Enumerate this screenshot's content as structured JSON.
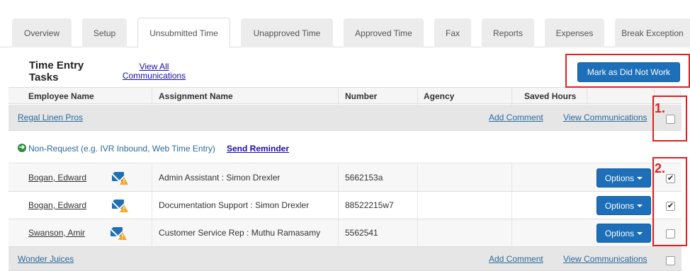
{
  "tabs": [
    {
      "label": "Overview"
    },
    {
      "label": "Setup"
    },
    {
      "label": "Unsubmitted Time"
    },
    {
      "label": "Unapproved Time"
    },
    {
      "label": "Approved Time"
    },
    {
      "label": "Fax"
    },
    {
      "label": "Reports"
    },
    {
      "label": "Expenses"
    },
    {
      "label": "Break Exception"
    }
  ],
  "header": {
    "title": "Time Entry Tasks",
    "view_all": "View All Communications",
    "mark_button": "Mark as Did Not Work"
  },
  "annotations": {
    "one": "1.",
    "two": "2."
  },
  "columns": [
    "Employee Name",
    "Assignment Name",
    "Number",
    "Agency",
    "Saved Hours"
  ],
  "groups": [
    {
      "name": "Regal Linen Pros",
      "add_comment": "Add Comment",
      "view_comms": "View Communications",
      "checked": false
    },
    {
      "name": "Wonder Juices",
      "add_comment": "Add Comment",
      "view_comms": "View Communications",
      "checked": false
    }
  ],
  "subheader": {
    "label": "Non-Request (e.g. IVR Inbound, Web Time Entry)",
    "send_reminder": "Send Reminder"
  },
  "rows": [
    {
      "employee": "Bogan, Edward",
      "assignment": "Admin Assistant : Simon Drexler",
      "number": "5662153a",
      "agency": "",
      "saved_hours": "",
      "options": "Options",
      "checked": true
    },
    {
      "employee": "Bogan, Edward",
      "assignment": "Documentation Support : Simon Drexler",
      "number": "88522215w7",
      "agency": "",
      "saved_hours": "",
      "options": "Options",
      "checked": true
    },
    {
      "employee": "Swanson, Amir",
      "assignment": "Customer Service Rep : Muthu Ramasamy",
      "number": "5562541",
      "agency": "",
      "saved_hours": "",
      "options": "Options",
      "checked": false
    }
  ],
  "colors": {
    "accent": "#1c6fb8",
    "annotation": "#e02020",
    "link": "#2a6a9c"
  }
}
